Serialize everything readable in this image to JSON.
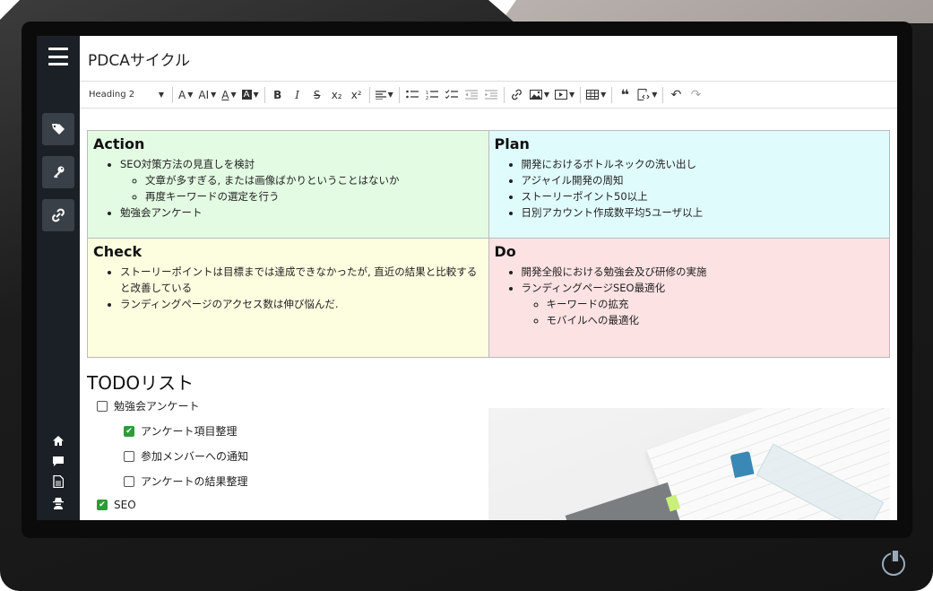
{
  "page": {
    "title": "PDCAサイクル"
  },
  "sidebar": {
    "top_icons": [
      "tags-icon",
      "key-icon",
      "link-icon"
    ],
    "bottom_icons": [
      "home-icon",
      "comment-icon",
      "document-icon",
      "user-secret-icon"
    ]
  },
  "toolbar": {
    "heading": "Heading 2",
    "font_size_label": "A",
    "font_family_label": "AI",
    "font_color_label": "A",
    "bg_color_label": "A",
    "bold": "B",
    "italic": "I",
    "strike": "S",
    "subscript": "x₂",
    "superscript": "x²"
  },
  "pdca": {
    "action": {
      "title": "Action",
      "items": [
        "SEO対策方法の見直しを検討",
        "勉強会アンケート"
      ],
      "sub_items": [
        "文章が多すぎる, または画像ばかりということはないか",
        "再度キーワードの選定を行う"
      ]
    },
    "plan": {
      "title": "Plan",
      "items": [
        "開発におけるボトルネックの洗い出し",
        "アジャイル開発の周知",
        "ストーリーポイント50以上",
        "日別アカウント作成数平均5ユーザ以上"
      ]
    },
    "check": {
      "title": "Check",
      "items": [
        "ストーリーポイントは目標までは達成できなかったが, 直近の結果と比較すると改善している",
        "ランディングページのアクセス数は伸び悩んだ."
      ]
    },
    "do": {
      "title": "Do",
      "items": [
        "開発全般における勉強会及び研修の実施",
        "ランディングページSEO最適化"
      ],
      "sub_items": [
        "キーワードの拡充",
        "モバイルへの最適化"
      ]
    }
  },
  "todo": {
    "title": "TODOリスト",
    "items": [
      {
        "label": "勉強会アンケート",
        "checked": false
      },
      {
        "label": "アンケート項目整理",
        "checked": true
      },
      {
        "label": "参加メンバーへの通知",
        "checked": false
      },
      {
        "label": "アンケートの結果整理",
        "checked": false
      },
      {
        "label": "SEO",
        "checked": true
      }
    ]
  },
  "colors": {
    "sidebar_bg": "#1b2027",
    "action_bg": "#e2fbe2",
    "plan_bg": "#e0fbfc",
    "check_bg": "#fdfde0",
    "do_bg": "#fde2e3",
    "checkbox_checked": "#2e9b3a"
  }
}
